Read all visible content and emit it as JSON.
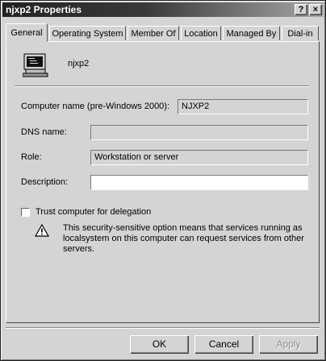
{
  "window": {
    "title": "njxp2 Properties",
    "help_glyph": "?",
    "close_glyph": "×"
  },
  "tabs": [
    {
      "label": "General",
      "active": true
    },
    {
      "label": "Operating System",
      "active": false
    },
    {
      "label": "Member Of",
      "active": false
    },
    {
      "label": "Location",
      "active": false
    },
    {
      "label": "Managed By",
      "active": false
    },
    {
      "label": "Dial-in",
      "active": false
    }
  ],
  "general": {
    "object_name": "njxp2",
    "computer_name_label": "Computer name (pre-Windows 2000):",
    "computer_name_value": "NJXP2",
    "dns_label": "DNS name:",
    "dns_value": "",
    "role_label": "Role:",
    "role_value": "Workstation or server",
    "description_label": "Description:",
    "description_value": "",
    "trust_label": "Trust computer for delegation",
    "trust_checked": false,
    "warning_text": "This security-sensitive option means that services running as localsystem on this computer can request services from other servers."
  },
  "buttons": {
    "ok": "OK",
    "cancel": "Cancel",
    "apply": "Apply",
    "apply_enabled": false
  },
  "icons": {
    "computer": "computer-icon",
    "warning": "warning-icon"
  },
  "colors": {
    "titlebar_dark": "#222222",
    "dialog_bg": "#d4d4d4"
  }
}
